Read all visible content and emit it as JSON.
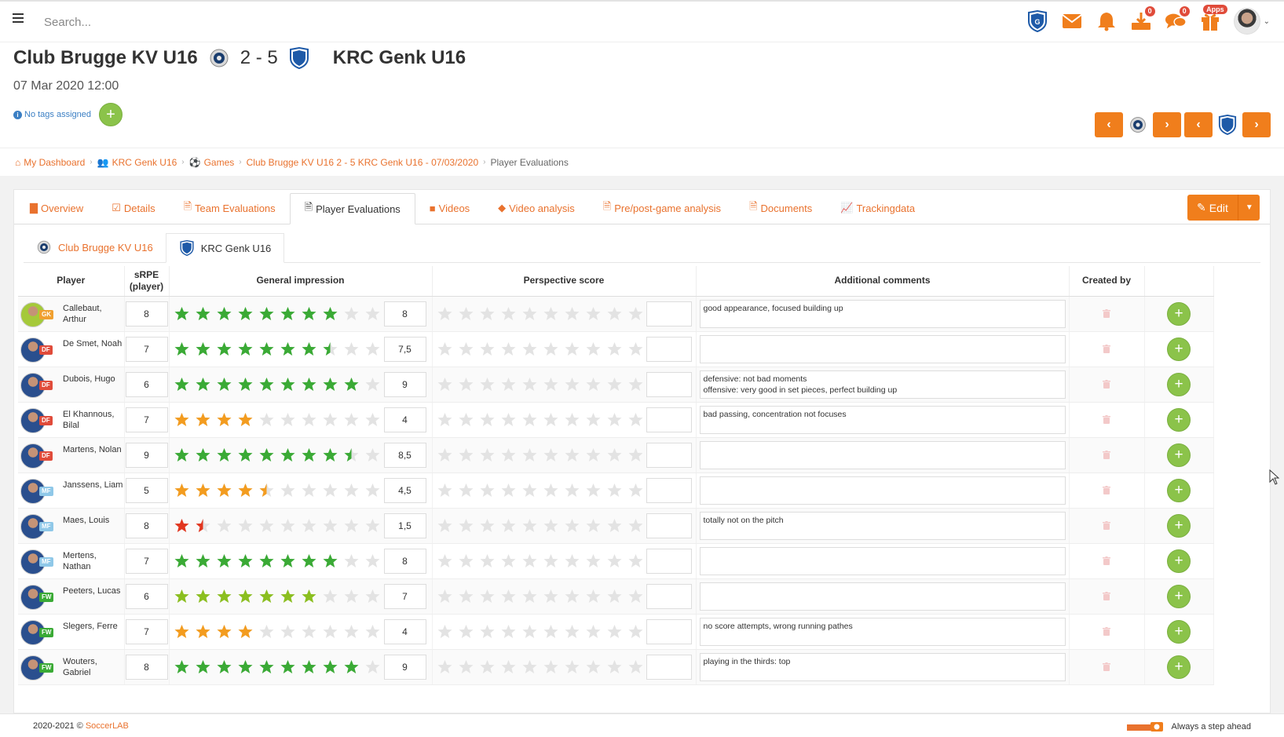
{
  "search": {
    "placeholder": "Search..."
  },
  "topbar": {
    "notifications": [
      {
        "name": "club-logo",
        "badge": ""
      },
      {
        "name": "mail",
        "badge": ""
      },
      {
        "name": "bell",
        "badge": ""
      },
      {
        "name": "downloads",
        "badge": "0"
      },
      {
        "name": "chat",
        "badge": "0"
      },
      {
        "name": "apps",
        "badge": "Apps"
      }
    ]
  },
  "match": {
    "home": "Club Brugge KV U16",
    "score": "2 - 5",
    "away": "KRC Genk U16",
    "date": "07 Mar 2020 12:00",
    "tags": "No tags assigned"
  },
  "breadcrumb": [
    {
      "label": "My Dashboard",
      "icon": "home-icon"
    },
    {
      "label": "KRC Genk U16",
      "icon": "users-icon"
    },
    {
      "label": "Games",
      "icon": "soccer-ball-icon"
    },
    {
      "label": "Club Brugge KV U16 2 - 5 KRC Genk U16 - 07/03/2020",
      "icon": ""
    },
    {
      "label": "Player Evaluations",
      "icon": ""
    }
  ],
  "tabs": [
    {
      "label": "Overview",
      "icon": "file-icon"
    },
    {
      "label": "Details",
      "icon": "checkbox-icon"
    },
    {
      "label": "Team Evaluations",
      "icon": "document-icon"
    },
    {
      "label": "Player Evaluations",
      "icon": "document-icon",
      "active": true
    },
    {
      "label": "Videos",
      "icon": "video-icon"
    },
    {
      "label": "Video analysis",
      "icon": "tags-icon"
    },
    {
      "label": "Pre/post-game analysis",
      "icon": "document-icon"
    },
    {
      "label": "Documents",
      "icon": "document-icon"
    },
    {
      "label": "Trackingdata",
      "icon": "line-chart-icon"
    }
  ],
  "edit_label": "Edit",
  "subtabs": [
    {
      "label": "Club Brugge KV U16"
    },
    {
      "label": "KRC Genk U16",
      "active": true
    }
  ],
  "table": {
    "headers": {
      "player": "Player",
      "srpe": "sRPE (player)",
      "general": "General impression",
      "perspective": "Perspective score",
      "comments": "Additional comments",
      "created": "Created by"
    },
    "rows": [
      {
        "name": "Callebaut, Arthur",
        "pos": "GK",
        "srpe": "8",
        "rating": 8,
        "rating_text": "8",
        "perspective": "",
        "comment": "good appearance, focused building up"
      },
      {
        "name": "De Smet, Noah",
        "pos": "DF",
        "srpe": "7",
        "rating": 7.5,
        "rating_text": "7,5",
        "perspective": "",
        "comment": ""
      },
      {
        "name": "Dubois, Hugo",
        "pos": "DF",
        "srpe": "6",
        "rating": 9,
        "rating_text": "9",
        "perspective": "",
        "comment": "defensive: not bad moments\noffensive: very good in set pieces, perfect building up"
      },
      {
        "name": "El Khannous, Bilal",
        "pos": "DF",
        "srpe": "7",
        "rating": 4,
        "rating_text": "4",
        "perspective": "",
        "comment": "bad passing, concentration not focuses"
      },
      {
        "name": "Martens, Nolan",
        "pos": "DF",
        "srpe": "9",
        "rating": 8.5,
        "rating_text": "8,5",
        "perspective": "",
        "comment": ""
      },
      {
        "name": "Janssens, Liam",
        "pos": "MF",
        "srpe": "5",
        "rating": 4.5,
        "rating_text": "4,5",
        "perspective": "",
        "comment": ""
      },
      {
        "name": "Maes, Louis",
        "pos": "MF",
        "srpe": "8",
        "rating": 1.5,
        "rating_text": "1,5",
        "perspective": "",
        "comment": "totally not on the pitch"
      },
      {
        "name": "Mertens, Nathan",
        "pos": "MF",
        "srpe": "7",
        "rating": 8,
        "rating_text": "8",
        "perspective": "",
        "comment": ""
      },
      {
        "name": "Peeters, Lucas",
        "pos": "FW",
        "srpe": "6",
        "rating": 7,
        "rating_text": "7",
        "perspective": "",
        "comment": ""
      },
      {
        "name": "Slegers, Ferre",
        "pos": "FW",
        "srpe": "7",
        "rating": 4,
        "rating_text": "4",
        "perspective": "",
        "comment": "no score attempts, wrong running pathes"
      },
      {
        "name": "Wouters, Gabriel",
        "pos": "FW",
        "srpe": "8",
        "rating": 9,
        "rating_text": "9",
        "perspective": "",
        "comment": "playing in the thirds: top"
      }
    ],
    "max_stars": 10
  },
  "colors": {
    "accent": "#f07e1c",
    "star_high": "#3aaa35",
    "star_mid": "#8bbf1f",
    "star_low": "#f39c1f",
    "star_bad": "#e2361f",
    "star_empty": "#e3e3e3",
    "pos_GK": "#f0a030",
    "pos_DF": "#e04b3a",
    "pos_MF": "#8fc8e8",
    "pos_FW": "#3aaa35"
  },
  "footer": {
    "years": "2020-2021 ©",
    "brand": "SoccerLAB",
    "slogan": "Always a step ahead"
  }
}
